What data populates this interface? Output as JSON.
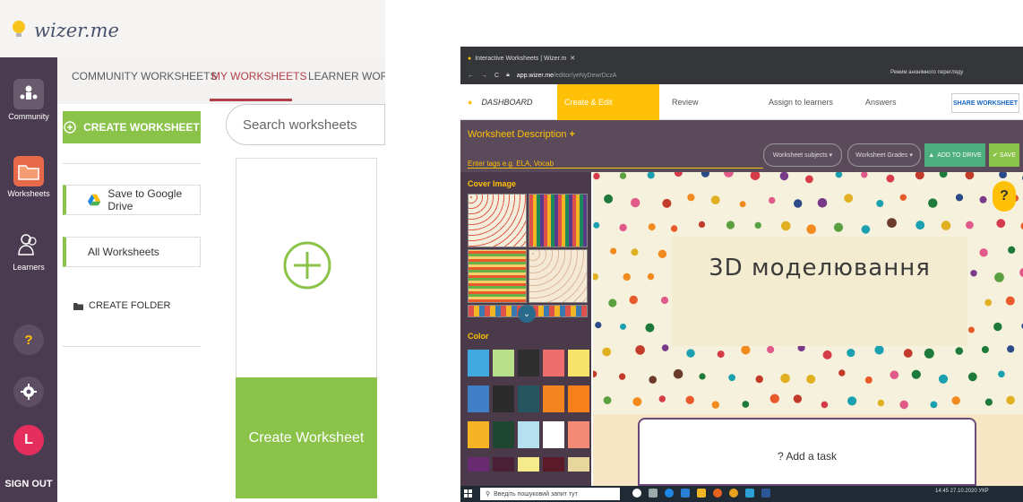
{
  "left": {
    "logo_text": "wizer.me",
    "tabs": [
      "COMMUNITY WORKSHEETS",
      "MY WORKSHEETS",
      "LEARNER WORKS"
    ],
    "rail": {
      "community": "Community",
      "worksheets": "Worksheets",
      "learners": "Learners",
      "help": "?",
      "avatar": "L",
      "signout": "SIGN OUT"
    },
    "create_worksheet": "CREATE WORKSHEET",
    "save_to_drive": "Save to Google Drive",
    "all_worksheets": "All Worksheets",
    "create_folder": "CREATE FOLDER",
    "search_placeholder": "Search worksheets",
    "card_label": "Create Worksheet"
  },
  "right": {
    "browser_tab": "Interactive Worksheets | Wizer.m",
    "url_main": "app.wizer.me",
    "url_rest": "/editor/yeNyDewrDczA",
    "incognito": "Режим анонімного перегляду",
    "nav": {
      "dashboard": "DASHBOARD",
      "steps": [
        "Create & Edit",
        "Review",
        "Assign to learners",
        "Answers"
      ],
      "share": "SHARE WORKSHEET"
    },
    "desc_title": "Worksheet Description",
    "tags_placeholder": "Enter tags e.g. ELA, Vocab",
    "subjects": "Worksheet subjects ▾",
    "grades": "Worksheet Grades ▾",
    "add_to_drive": "ADD TO DRIVE",
    "save": "✔ SAVE",
    "cover_image_label": "Cover Image",
    "color_label": "Color",
    "worksheet_title": "3D моделювання",
    "help": "?",
    "add_task": "?  Add a task",
    "taskbar_search": "Введіть пошуковий запит тут",
    "tray": "14:45  27.10.2020  УКР"
  },
  "colors": {
    "wizer_green": "#8bc34a",
    "rail_purple": "#4b3b50",
    "accent_red": "#b23e4a",
    "yellow": "#ffc107"
  },
  "swatches": [
    "#3fa9e0",
    "#b8e08a",
    "#2e2e2e",
    "#ee6e6e",
    "#f5e36a",
    "#3f7fc5",
    "#2b2b2b",
    "#255560",
    "#f2851e",
    "#f7801a",
    "#f6b324",
    "#1e4630",
    "#b4e0f0",
    "#ffffff",
    "#f28a76",
    "#6a2a72",
    "#4a2036",
    "#f5eb8c",
    "#5a1a2a",
    "#e8d79c"
  ],
  "dots": [
    "#e85a2a",
    "#1d7a3a",
    "#d63b4a",
    "#7a3a8a",
    "#f28a1e",
    "#2a4a8a",
    "#6a3a2a",
    "#c23a2a",
    "#e0b020",
    "#1aa0b0",
    "#5aa040",
    "#e05a8a"
  ]
}
